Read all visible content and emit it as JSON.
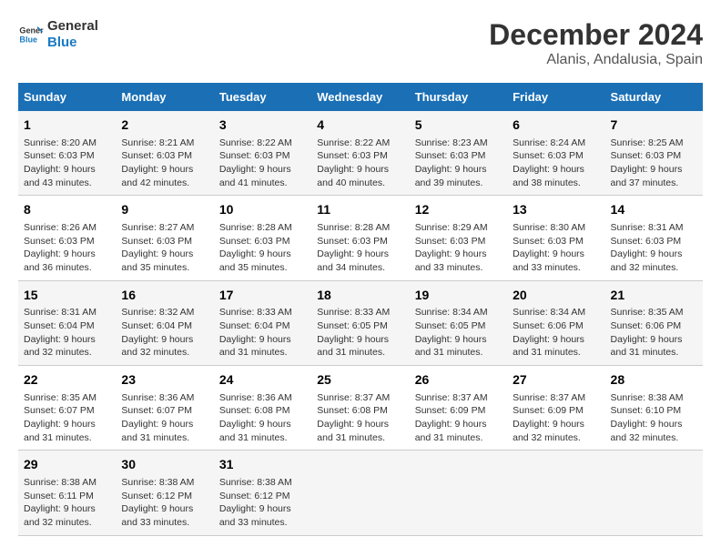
{
  "header": {
    "logo_line1": "General",
    "logo_line2": "Blue",
    "title": "December 2024",
    "subtitle": "Alanis, Andalusia, Spain"
  },
  "weekdays": [
    "Sunday",
    "Monday",
    "Tuesday",
    "Wednesday",
    "Thursday",
    "Friday",
    "Saturday"
  ],
  "weeks": [
    [
      {
        "day": "1",
        "info": "Sunrise: 8:20 AM\nSunset: 6:03 PM\nDaylight: 9 hours\nand 43 minutes."
      },
      {
        "day": "2",
        "info": "Sunrise: 8:21 AM\nSunset: 6:03 PM\nDaylight: 9 hours\nand 42 minutes."
      },
      {
        "day": "3",
        "info": "Sunrise: 8:22 AM\nSunset: 6:03 PM\nDaylight: 9 hours\nand 41 minutes."
      },
      {
        "day": "4",
        "info": "Sunrise: 8:22 AM\nSunset: 6:03 PM\nDaylight: 9 hours\nand 40 minutes."
      },
      {
        "day": "5",
        "info": "Sunrise: 8:23 AM\nSunset: 6:03 PM\nDaylight: 9 hours\nand 39 minutes."
      },
      {
        "day": "6",
        "info": "Sunrise: 8:24 AM\nSunset: 6:03 PM\nDaylight: 9 hours\nand 38 minutes."
      },
      {
        "day": "7",
        "info": "Sunrise: 8:25 AM\nSunset: 6:03 PM\nDaylight: 9 hours\nand 37 minutes."
      }
    ],
    [
      {
        "day": "8",
        "info": "Sunrise: 8:26 AM\nSunset: 6:03 PM\nDaylight: 9 hours\nand 36 minutes."
      },
      {
        "day": "9",
        "info": "Sunrise: 8:27 AM\nSunset: 6:03 PM\nDaylight: 9 hours\nand 35 minutes."
      },
      {
        "day": "10",
        "info": "Sunrise: 8:28 AM\nSunset: 6:03 PM\nDaylight: 9 hours\nand 35 minutes."
      },
      {
        "day": "11",
        "info": "Sunrise: 8:28 AM\nSunset: 6:03 PM\nDaylight: 9 hours\nand 34 minutes."
      },
      {
        "day": "12",
        "info": "Sunrise: 8:29 AM\nSunset: 6:03 PM\nDaylight: 9 hours\nand 33 minutes."
      },
      {
        "day": "13",
        "info": "Sunrise: 8:30 AM\nSunset: 6:03 PM\nDaylight: 9 hours\nand 33 minutes."
      },
      {
        "day": "14",
        "info": "Sunrise: 8:31 AM\nSunset: 6:03 PM\nDaylight: 9 hours\nand 32 minutes."
      }
    ],
    [
      {
        "day": "15",
        "info": "Sunrise: 8:31 AM\nSunset: 6:04 PM\nDaylight: 9 hours\nand 32 minutes."
      },
      {
        "day": "16",
        "info": "Sunrise: 8:32 AM\nSunset: 6:04 PM\nDaylight: 9 hours\nand 32 minutes."
      },
      {
        "day": "17",
        "info": "Sunrise: 8:33 AM\nSunset: 6:04 PM\nDaylight: 9 hours\nand 31 minutes."
      },
      {
        "day": "18",
        "info": "Sunrise: 8:33 AM\nSunset: 6:05 PM\nDaylight: 9 hours\nand 31 minutes."
      },
      {
        "day": "19",
        "info": "Sunrise: 8:34 AM\nSunset: 6:05 PM\nDaylight: 9 hours\nand 31 minutes."
      },
      {
        "day": "20",
        "info": "Sunrise: 8:34 AM\nSunset: 6:06 PM\nDaylight: 9 hours\nand 31 minutes."
      },
      {
        "day": "21",
        "info": "Sunrise: 8:35 AM\nSunset: 6:06 PM\nDaylight: 9 hours\nand 31 minutes."
      }
    ],
    [
      {
        "day": "22",
        "info": "Sunrise: 8:35 AM\nSunset: 6:07 PM\nDaylight: 9 hours\nand 31 minutes."
      },
      {
        "day": "23",
        "info": "Sunrise: 8:36 AM\nSunset: 6:07 PM\nDaylight: 9 hours\nand 31 minutes."
      },
      {
        "day": "24",
        "info": "Sunrise: 8:36 AM\nSunset: 6:08 PM\nDaylight: 9 hours\nand 31 minutes."
      },
      {
        "day": "25",
        "info": "Sunrise: 8:37 AM\nSunset: 6:08 PM\nDaylight: 9 hours\nand 31 minutes."
      },
      {
        "day": "26",
        "info": "Sunrise: 8:37 AM\nSunset: 6:09 PM\nDaylight: 9 hours\nand 31 minutes."
      },
      {
        "day": "27",
        "info": "Sunrise: 8:37 AM\nSunset: 6:09 PM\nDaylight: 9 hours\nand 32 minutes."
      },
      {
        "day": "28",
        "info": "Sunrise: 8:38 AM\nSunset: 6:10 PM\nDaylight: 9 hours\nand 32 minutes."
      }
    ],
    [
      {
        "day": "29",
        "info": "Sunrise: 8:38 AM\nSunset: 6:11 PM\nDaylight: 9 hours\nand 32 minutes."
      },
      {
        "day": "30",
        "info": "Sunrise: 8:38 AM\nSunset: 6:12 PM\nDaylight: 9 hours\nand 33 minutes."
      },
      {
        "day": "31",
        "info": "Sunrise: 8:38 AM\nSunset: 6:12 PM\nDaylight: 9 hours\nand 33 minutes."
      },
      {
        "day": "",
        "info": ""
      },
      {
        "day": "",
        "info": ""
      },
      {
        "day": "",
        "info": ""
      },
      {
        "day": "",
        "info": ""
      }
    ]
  ]
}
